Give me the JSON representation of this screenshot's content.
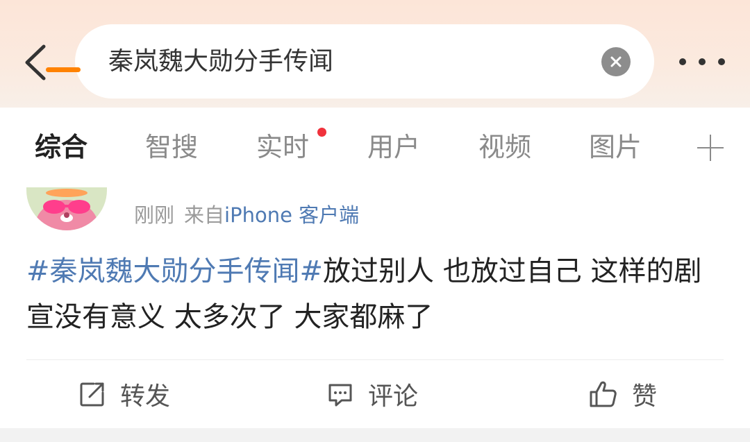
{
  "search": {
    "query": "秦岚魏大勋分手传闻"
  },
  "tabs": [
    {
      "label": "综合",
      "active": true
    },
    {
      "label": "智搜"
    },
    {
      "label": "实时",
      "has_dot": true
    },
    {
      "label": "用户"
    },
    {
      "label": "视频"
    },
    {
      "label": "图片"
    }
  ],
  "post": {
    "time": "刚刚",
    "from_label": "来自",
    "device": "iPhone 客户端",
    "topic": "#秦岚魏大勋分手传闻#",
    "body": "放过别人 也放过自己 这样的剧宣没有意义 太多次了 大家都麻了"
  },
  "actions": {
    "repost": "转发",
    "comment": "评论",
    "like": "赞"
  },
  "colors": {
    "accent": "#ff8200",
    "link": "#4f7ab3",
    "notification_dot": "#f0323c"
  },
  "icons": [
    "back-icon",
    "clear-icon",
    "more-icon",
    "add-tab-icon",
    "repost-icon",
    "comment-icon",
    "like-icon"
  ]
}
